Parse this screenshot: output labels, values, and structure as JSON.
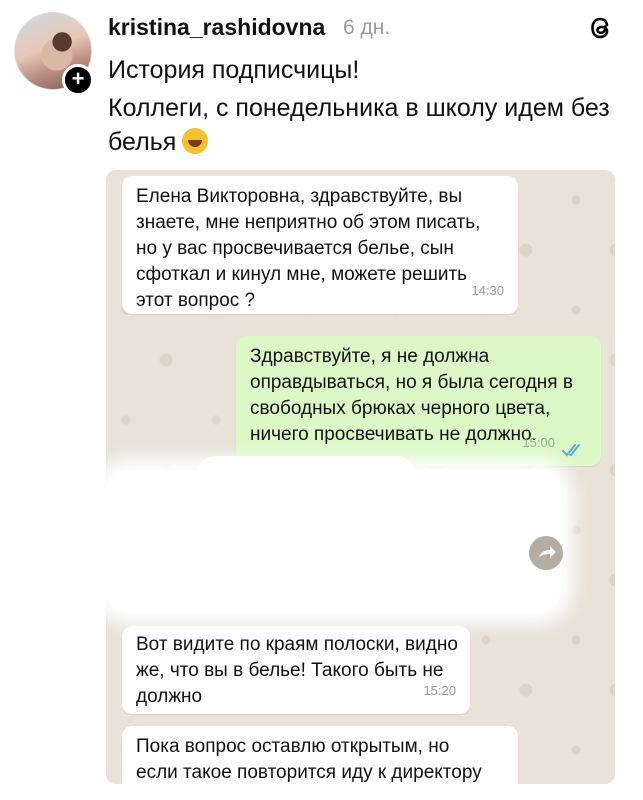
{
  "post": {
    "username": "kristina_rashidovna",
    "time_ago": "6 дн.",
    "line1": "История подписчицы!",
    "line2": "Коллеги, с понедельника в школу идем без",
    "line3": "белья"
  },
  "icons": {
    "avatar": "avatar",
    "follow": "plus-icon",
    "threads": "threads-logo-icon",
    "emoji": "rofl-emoji-icon",
    "read": "double-check-icon",
    "forward": "forward-icon"
  },
  "chat": {
    "messages": [
      {
        "direction": "incoming",
        "text": "Елена Викторовна, здравствуйте, вы\nзнаете, мне неприятно об этом писать,\nно у вас просвечивается белье, сын\nсфоткал и кинул мне, можете решить\nэтот вопрос ?",
        "time": "14:30"
      },
      {
        "direction": "outgoing",
        "text": "Здравствуйте, я не должна\nоправдываться, но я была сегодня в\nсвободных брюках черного цвета,\nничего просвечивать не должно.",
        "time": "15:00"
      },
      {
        "direction": "incoming",
        "text": "Вот видите по краям полоски, видно\nже, что вы в белье! Такого быть не\nдолжно",
        "time": "15:20"
      },
      {
        "direction": "incoming",
        "text": "Пока вопрос оставлю открытым, но\nесли такое повторится иду к директору",
        "time": ""
      }
    ]
  },
  "colors": {
    "incoming_bubble": "#ffffff",
    "outgoing_bubble": "#dcf8c6",
    "chat_background": "#e8e2d8",
    "read_ticks": "#4fa9e6"
  }
}
